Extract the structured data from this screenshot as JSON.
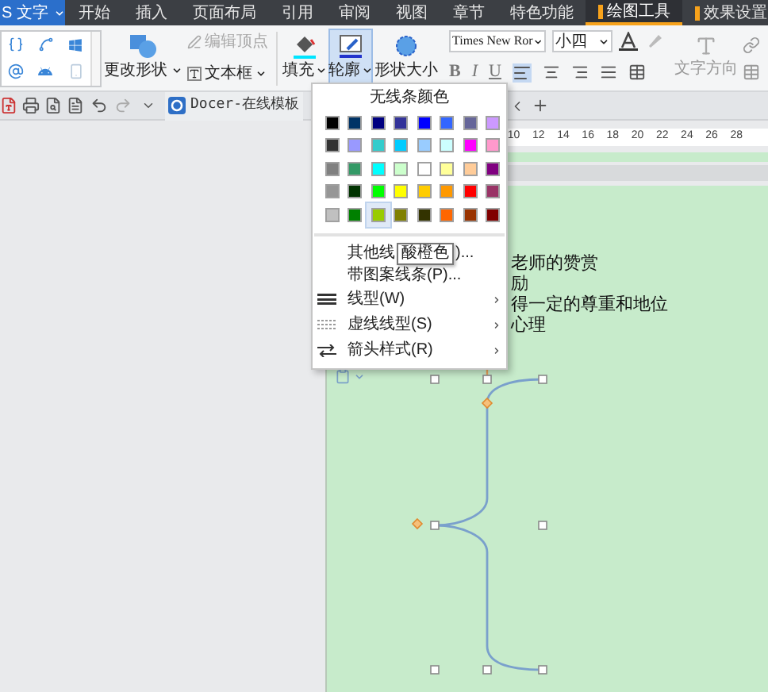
{
  "app_button": {
    "label": "S 文字"
  },
  "menu_tabs": [
    {
      "label": "开始",
      "selected": false,
      "kind": "normal"
    },
    {
      "label": "插入",
      "selected": false,
      "kind": "normal"
    },
    {
      "label": "页面布局",
      "selected": false,
      "kind": "normal"
    },
    {
      "label": "引用",
      "selected": false,
      "kind": "normal"
    },
    {
      "label": "审阅",
      "selected": false,
      "kind": "normal"
    },
    {
      "label": "视图",
      "selected": false,
      "kind": "normal"
    },
    {
      "label": "章节",
      "selected": false,
      "kind": "normal"
    },
    {
      "label": "特色功能",
      "selected": false,
      "kind": "normal"
    },
    {
      "label": "绘图工具",
      "selected": true,
      "kind": "context"
    },
    {
      "label": "效果设置",
      "selected": false,
      "kind": "context"
    }
  ],
  "ribbon": {
    "change_shape": "更改形状",
    "edit_points": {
      "label": "编辑顶点",
      "disabled": true
    },
    "text_box": "文本框",
    "fill": "填充",
    "outline": {
      "label": "轮廓",
      "selected": true
    },
    "shape_size": "形状大小",
    "font": "Times New Ror",
    "font_size": "小四",
    "format_buttons": [
      "B",
      "I",
      "U"
    ],
    "text_direction": "文字方向"
  },
  "quick_access": {
    "template_tab": "Docer-在线模板"
  },
  "ruler": [
    "10",
    "12",
    "14",
    "16",
    "18",
    "20",
    "22",
    "24",
    "26",
    "28"
  ],
  "document": {
    "lines": [
      "老师的赞赏",
      "励",
      "得一定的尊重和地位",
      "心理"
    ]
  },
  "outline_menu": {
    "title": "无线条颜色",
    "rows": [
      [
        {
          "color": "#000000",
          "selected": false
        },
        {
          "color": "#003366",
          "selected": false
        },
        {
          "color": "#000080",
          "selected": false
        },
        {
          "color": "#333399",
          "selected": false
        },
        {
          "color": "#0000ff",
          "selected": false
        },
        {
          "color": "#3366ff",
          "selected": false
        },
        {
          "color": "#666699",
          "selected": false
        },
        {
          "color": "#cc99ff",
          "selected": false
        }
      ],
      [
        {
          "color": "#333333",
          "selected": false
        },
        {
          "color": "#9999ff",
          "selected": false
        },
        {
          "color": "#33cccc",
          "selected": false
        },
        {
          "color": "#00ccff",
          "selected": false
        },
        {
          "color": "#99ccff",
          "selected": false
        },
        {
          "color": "#ccffff",
          "selected": false
        },
        {
          "color": "#ff00ff",
          "selected": false
        },
        {
          "color": "#ff99cc",
          "selected": false
        }
      ],
      [
        {
          "color": "#808080",
          "selected": false
        },
        {
          "color": "#339966",
          "selected": false
        },
        {
          "color": "#00ffff",
          "selected": false
        },
        {
          "color": "#ccffcc",
          "selected": false
        },
        {
          "color": "#ffffff",
          "selected": false
        },
        {
          "color": "#ffff99",
          "selected": false
        },
        {
          "color": "#ffcc99",
          "selected": false
        },
        {
          "color": "#800080",
          "selected": false
        }
      ],
      [
        {
          "color": "#969696",
          "selected": false
        },
        {
          "color": "#003300",
          "selected": false
        },
        {
          "color": "#00ff00",
          "selected": false
        },
        {
          "color": "#ffff00",
          "selected": false
        },
        {
          "color": "#ffcc00",
          "selected": false
        },
        {
          "color": "#ff9900",
          "selected": false
        },
        {
          "color": "#ff0000",
          "selected": false
        },
        {
          "color": "#993366",
          "selected": false
        }
      ],
      [
        {
          "color": "#c0c0c0",
          "selected": false
        },
        {
          "color": "#008000",
          "selected": false
        },
        {
          "color": "#99cc00",
          "selected": true
        },
        {
          "color": "#808000",
          "selected": false
        },
        {
          "color": "#333300",
          "selected": false
        },
        {
          "color": "#ff6600",
          "selected": false
        },
        {
          "color": "#993300",
          "selected": false
        },
        {
          "color": "#800000",
          "selected": false
        }
      ]
    ],
    "items": [
      {
        "kind": "covered",
        "label": "其他线",
        "tooltip": "酸橙色",
        "tail": ")..."
      },
      {
        "kind": "command",
        "label": "带图案线条(P)..."
      },
      {
        "kind": "submenu",
        "label": "线型(W)"
      },
      {
        "kind": "submenu",
        "label": "虚线线型(S)"
      },
      {
        "kind": "submenu",
        "label": "箭头样式(R)"
      }
    ]
  }
}
